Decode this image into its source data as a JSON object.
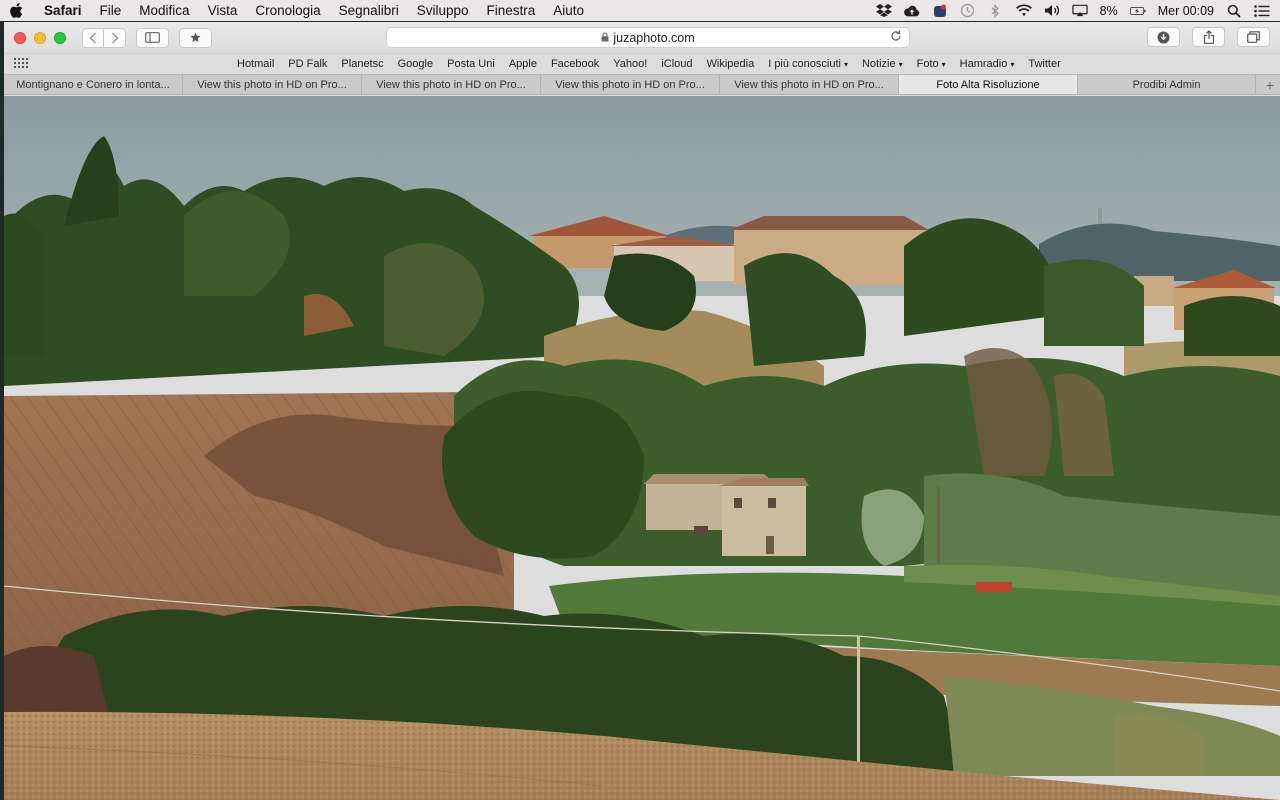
{
  "menubar": {
    "app": "Safari",
    "items": [
      "File",
      "Modifica",
      "Vista",
      "Cronologia",
      "Segnalibri",
      "Sviluppo",
      "Finestra",
      "Aiuto"
    ],
    "battery": "8%",
    "clock": "Mer 00:09"
  },
  "toolbar": {
    "url": "juzaphoto.com"
  },
  "favorites": [
    "Hotmail",
    "PD Falk",
    "Planetsc",
    "Google",
    "Posta Uni",
    "Apple",
    "Facebook",
    "Yahoo!",
    "iCloud",
    "Wikipedia"
  ],
  "favorites_menus": [
    "I più conosciuti",
    "Notizie",
    "Foto",
    "Hamradio"
  ],
  "favorites_last": "Twitter",
  "tabs": [
    {
      "label": "Montignano e Conero in lonta..."
    },
    {
      "label": "View this photo in HD on Pro..."
    },
    {
      "label": "View this photo in HD on Pro..."
    },
    {
      "label": "View this photo in HD on Pro..."
    },
    {
      "label": "View this photo in HD on Pro..."
    },
    {
      "label": "Foto Alta Risoluzione",
      "active": true
    },
    {
      "label": "Prodibi Admin"
    }
  ],
  "colors": {
    "sky": "#93a3a8",
    "field_brown": "#9b6e50",
    "field_green": "#4f7a39",
    "tree_dark": "#2e4a1f"
  }
}
